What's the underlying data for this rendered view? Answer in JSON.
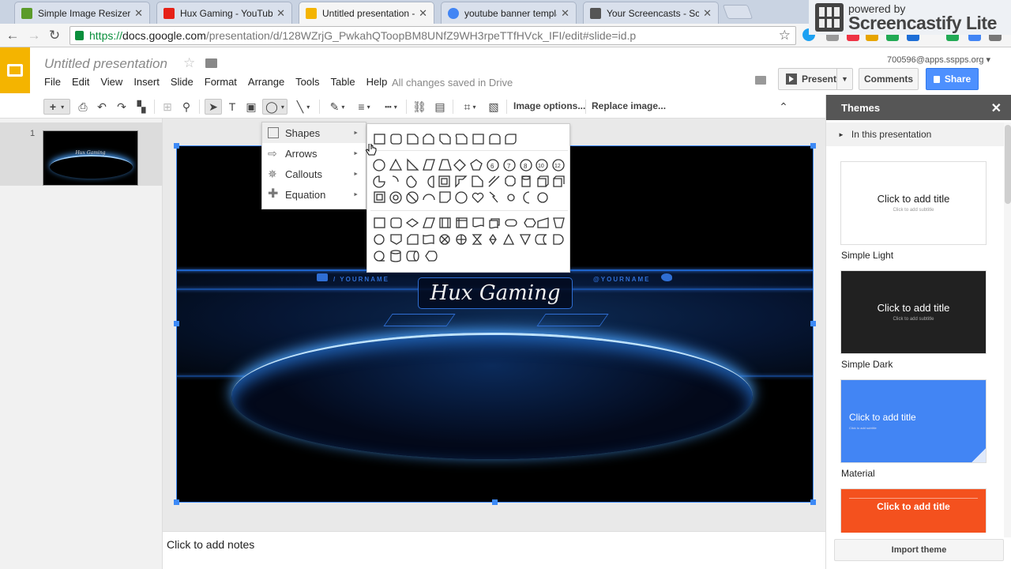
{
  "browser": {
    "tabs": [
      {
        "title": "Simple Image Resizer, re",
        "favicon_color": "#5b9b2a"
      },
      {
        "title": "Hux Gaming - YouTube",
        "favicon_color": "#e62117"
      },
      {
        "title": "Untitled presentation - G",
        "favicon_color": "#f4b400"
      },
      {
        "title": "youtube banner templat",
        "favicon_color": "#4285f4"
      },
      {
        "title": "Your Screencasts - Scre",
        "favicon_color": "#555555"
      }
    ],
    "url": {
      "protocol": "https://",
      "domain": "docs.google.com",
      "path": "/presentation/d/128WZrjG_PwkahQToopBM8UNfZ9WH3rpeTTfHVck_IFI/edit#slide=id.p"
    },
    "screencastify": {
      "line1": "powered by",
      "line2": "Screencastify Lite"
    }
  },
  "doc": {
    "title": "Untitled presentation",
    "menus": [
      "File",
      "Edit",
      "View",
      "Insert",
      "Slide",
      "Format",
      "Arrange",
      "Tools",
      "Table",
      "Help"
    ],
    "save_status": "All changes saved in Drive",
    "account": "700596@apps.sspps.org",
    "present_label": "Present",
    "comments_label": "Comments",
    "share_label": "Share"
  },
  "toolbar": {
    "image_options": "Image options...",
    "replace_image": "Replace image..."
  },
  "filmstrip": {
    "slide_number": "1",
    "thumb_title": "Hux Gaming"
  },
  "slide": {
    "title": "Hux Gaming",
    "left_label": "/ YOURNAME",
    "right_label": "@YOURNAME"
  },
  "notes_placeholder": "Click to add notes",
  "insert_menu": [
    {
      "label": "Shapes"
    },
    {
      "label": "Arrows"
    },
    {
      "label": "Callouts"
    },
    {
      "label": "Equation"
    }
  ],
  "themes": {
    "title": "Themes",
    "in_presentation": "In this presentation",
    "items": [
      {
        "name": "Simple Light",
        "title": "Click to add title",
        "subtitle": "Click to add subtitle",
        "bg": "#ffffff",
        "fg": "#222222"
      },
      {
        "name": "Simple Dark",
        "title": "Click to add title",
        "subtitle": "Click to add subtitle",
        "bg": "#212121",
        "fg": "#ffffff"
      },
      {
        "name": "Material",
        "title": "Click to add title",
        "subtitle": "Click to add subtitle",
        "bg": "#4285f4",
        "fg": "#ffffff"
      },
      {
        "name": "",
        "title": "Click to add title",
        "subtitle": "",
        "bg": "#f4511e",
        "fg": "#ffffff"
      }
    ],
    "import_label": "Import theme"
  }
}
